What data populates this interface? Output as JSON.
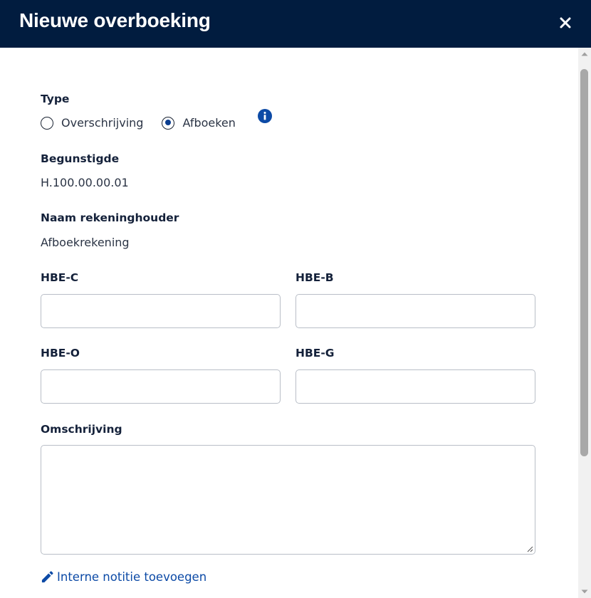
{
  "modal": {
    "title": "Nieuwe overboeking",
    "close_icon": "close-icon"
  },
  "type": {
    "label": "Type",
    "options": [
      {
        "label": "Overschrijving",
        "checked": false
      },
      {
        "label": "Afboeken",
        "checked": true
      }
    ],
    "info_icon": "info-icon"
  },
  "beneficiary": {
    "label": "Begunstigde",
    "value": "H.100.00.00.01"
  },
  "account_holder": {
    "label": "Naam rekeninghouder",
    "value": "Afboekrekening"
  },
  "fields": {
    "hbe_c": {
      "label": "HBE-C",
      "value": ""
    },
    "hbe_b": {
      "label": "HBE-B",
      "value": ""
    },
    "hbe_o": {
      "label": "HBE-O",
      "value": ""
    },
    "hbe_g": {
      "label": "HBE-G",
      "value": ""
    }
  },
  "description": {
    "label": "Omschrijving",
    "value": ""
  },
  "note_link": {
    "label": "Interne notitie toevoegen",
    "icon": "pencil-icon"
  },
  "colors": {
    "header_bg": "#011c3f",
    "accent": "#0c4aa6",
    "text": "#14213a"
  }
}
